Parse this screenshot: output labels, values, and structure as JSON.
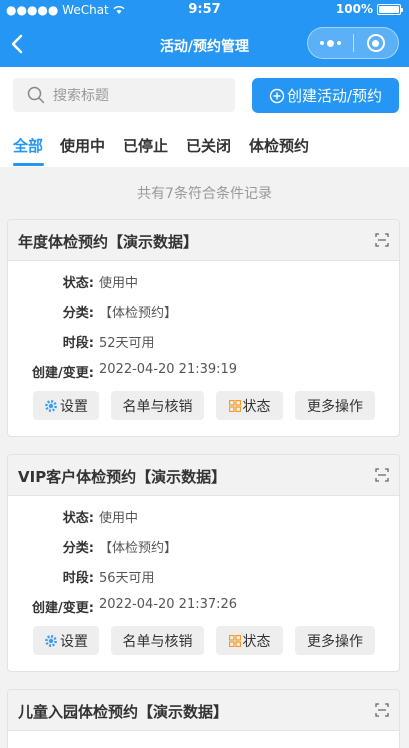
{
  "status_bar": {
    "carrier": "●●●●● WeChat",
    "time": "9:57",
    "battery": "100%"
  },
  "nav": {
    "title": "活动/预约管理"
  },
  "search": {
    "placeholder": "搜索标题"
  },
  "create_button": {
    "label": "创建活动/预约"
  },
  "tabs": [
    {
      "label": "全部",
      "active": true
    },
    {
      "label": "使用中",
      "active": false
    },
    {
      "label": "已停止",
      "active": false
    },
    {
      "label": "已关闭",
      "active": false
    },
    {
      "label": "体检预约",
      "active": false
    }
  ],
  "summary": "共有7条符合条件记录",
  "field_labels": {
    "status": "状态:",
    "category": "分类:",
    "period": "时段:",
    "created": "创建/变更:"
  },
  "buttons": {
    "settings": "设置",
    "roster": "名单与核销",
    "status": "状态",
    "more": "更多操作"
  },
  "cards": [
    {
      "title": "年度体检预约【演示数据】",
      "status": "使用中",
      "category": "【体检预约】",
      "period": "52天可用",
      "created": "2022-04-20 21:39:19"
    },
    {
      "title": "VIP客户体检预约【演示数据】",
      "status": "使用中",
      "category": "【体检预约】",
      "period": "56天可用",
      "created": "2022-04-20 21:37:26"
    },
    {
      "title": "儿童入园体检预约【演示数据】"
    }
  ],
  "colors": {
    "brand": "#2596f3",
    "settings_icon": "#3b9cf0",
    "status_icon": "#f59a23"
  }
}
